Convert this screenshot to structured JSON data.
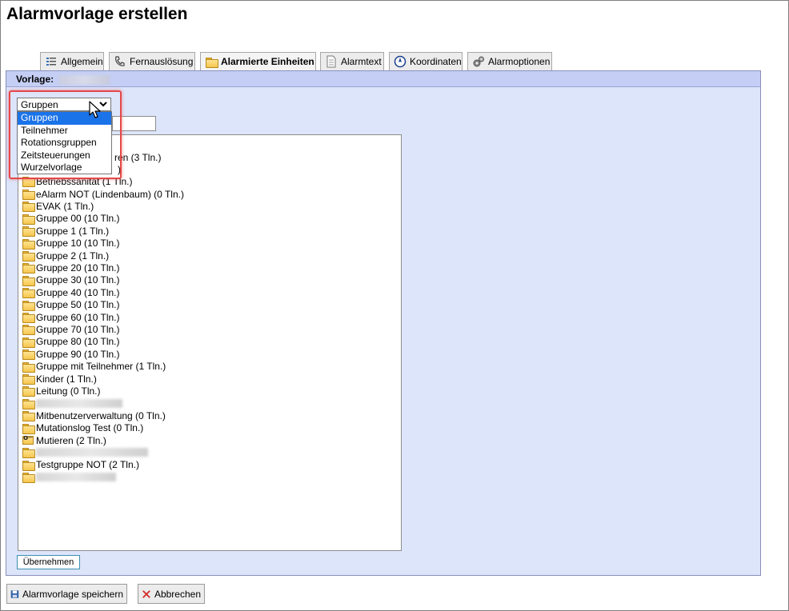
{
  "page": {
    "title": "Alarmvorlage erstellen"
  },
  "tabs": [
    {
      "label": "Allgemein",
      "icon": "list-icon",
      "active": false
    },
    {
      "label": "Fernauslösung",
      "icon": "phone-icon",
      "active": false
    },
    {
      "label": "Alarmierte Einheiten",
      "icon": "folder-icon",
      "active": true
    },
    {
      "label": "Alarmtext",
      "icon": "document-icon",
      "active": false
    },
    {
      "label": "Koordinaten",
      "icon": "compass-icon",
      "active": false
    },
    {
      "label": "Alarmoptionen",
      "icon": "gears-icon",
      "active": false
    }
  ],
  "panel": {
    "vorlage_label": "Vorlage:"
  },
  "select": {
    "value": "Gruppen",
    "options": [
      "Gruppen",
      "Teilnehmer",
      "Rotationsgruppen",
      "Zeitsteuerungen",
      "Wurzelvorlage"
    ],
    "selected_index": 0
  },
  "tree": {
    "partial_rows": [
      {
        "text": "ren (3 Tln.)"
      },
      {
        "text": ")"
      },
      {
        "text": "Betriebssanität (1 Tln.)"
      }
    ],
    "items": [
      {
        "label": "eAlarm NOT (Lindenbaum) (0 Tln.)",
        "icon": "folder-icon"
      },
      {
        "label": "EVAK (1 Tln.)",
        "icon": "folder-icon"
      },
      {
        "label": "Gruppe 00 (10 Tln.)",
        "icon": "folder-icon"
      },
      {
        "label": "Gruppe 1 (1 Tln.)",
        "icon": "folder-icon"
      },
      {
        "label": "Gruppe 10 (10 Tln.)",
        "icon": "folder-icon"
      },
      {
        "label": "Gruppe 2 (1 Tln.)",
        "icon": "folder-icon"
      },
      {
        "label": "Gruppe 20 (10 Tln.)",
        "icon": "folder-icon"
      },
      {
        "label": "Gruppe 30 (10 Tln.)",
        "icon": "folder-icon"
      },
      {
        "label": "Gruppe 40 (10 Tln.)",
        "icon": "folder-icon"
      },
      {
        "label": "Gruppe 50 (10 Tln.)",
        "icon": "folder-icon"
      },
      {
        "label": "Gruppe 60 (10 Tln.)",
        "icon": "folder-icon"
      },
      {
        "label": "Gruppe 70 (10 Tln.)",
        "icon": "folder-icon"
      },
      {
        "label": "Gruppe 80 (10 Tln.)",
        "icon": "folder-icon"
      },
      {
        "label": "Gruppe 90 (10 Tln.)",
        "icon": "folder-icon"
      },
      {
        "label": "Gruppe mit Teilnehmer (1 Tln.)",
        "icon": "folder-icon"
      },
      {
        "label": "Kinder (1 Tln.)",
        "icon": "folder-icon"
      },
      {
        "label": "Leitung (0 Tln.)",
        "icon": "folder-icon"
      },
      {
        "label": "",
        "icon": "folder-icon",
        "redacted": true
      },
      {
        "label": "Mitbenutzerverwaltung (0 Tln.)",
        "icon": "folder-icon"
      },
      {
        "label": "Mutationslog Test (0 Tln.)",
        "icon": "folder-icon"
      },
      {
        "label": "Mutieren (2 Tln.)",
        "icon": "key-icon"
      },
      {
        "label": "",
        "icon": "folder-icon",
        "redacted": true
      },
      {
        "label": "Testgruppe NOT (2 Tln.)",
        "icon": "folder-icon"
      },
      {
        "label": "",
        "icon": "folder-icon",
        "redacted": true
      }
    ]
  },
  "apply_button": "Übernehmen",
  "footer": {
    "save_label": "Alarmvorlage speichern",
    "cancel_label": "Abbrechen"
  },
  "colors": {
    "panel_bg": "#dde5fb",
    "panel_header": "#c5cff5",
    "selected_option": "#1a73e8",
    "highlight": "#e54848"
  }
}
